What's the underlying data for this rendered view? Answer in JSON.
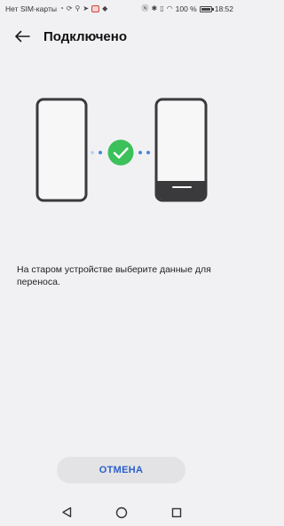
{
  "status_bar": {
    "carrier": "Нет SIM-карты",
    "battery_text": "100 %",
    "battery_level": 1.0,
    "time": "18:52"
  },
  "header": {
    "title": "Подключено"
  },
  "illustration": {
    "status": "connected",
    "icon": "check-icon",
    "accent_color": "#3cc05a",
    "dots_color": "#4a86d8"
  },
  "message": "На старом устройстве выберите данные для переноса.",
  "actions": {
    "cancel_label": "ОТМЕНА"
  },
  "colors": {
    "background": "#f1f1f3",
    "button_text": "#2b5fc9",
    "button_bg": "#e3e3e6"
  }
}
